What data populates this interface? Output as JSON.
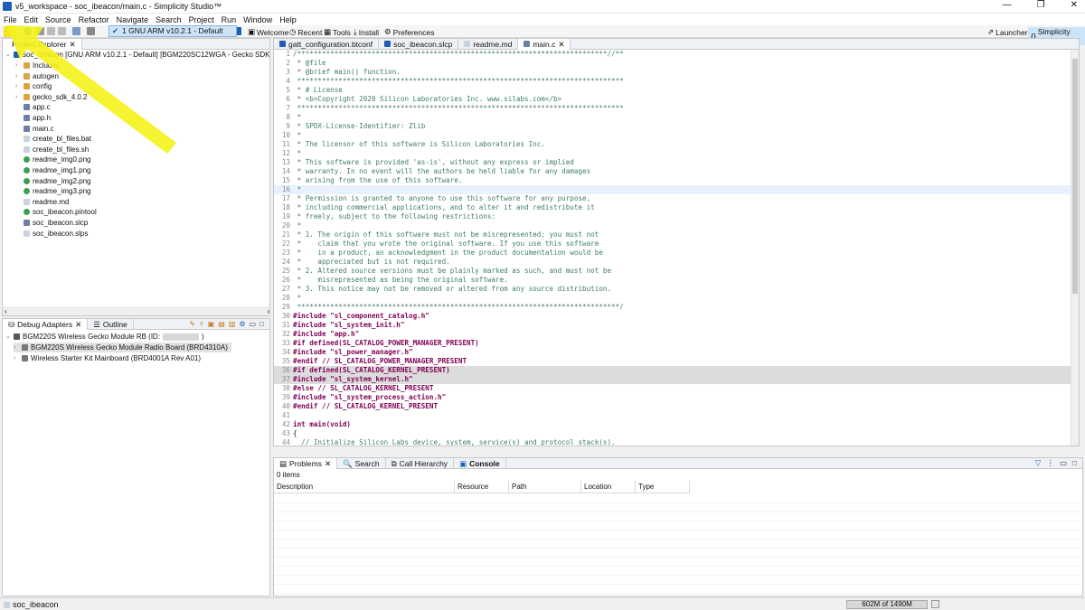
{
  "window": {
    "title": "v5_workspace - soc_ibeacon/main.c - Simplicity Studio™",
    "buttons": [
      "—",
      "❐",
      "✕"
    ]
  },
  "menu": [
    "File",
    "Edit",
    "Source",
    "Refactor",
    "Navigate",
    "Search",
    "Project",
    "Run",
    "Window",
    "Help"
  ],
  "toolbar": {
    "build_config": "1 GNU ARM v10.2.1 - Default",
    "links": [
      "Welcome",
      "Recent",
      "Tools",
      "Install",
      "Preferences"
    ],
    "perspectives": [
      "Launcher",
      "Simplicity IDE"
    ]
  },
  "project_explorer": {
    "tab_label": "Project Explorer",
    "root": "soc_ibeacon [GNU ARM v10.2.1 - Default] [BGM220SC12WGA - Gecko SDK Suite: A",
    "items": [
      {
        "label": "Includes",
        "type": "folder"
      },
      {
        "label": "autogen",
        "type": "folder"
      },
      {
        "label": "config",
        "type": "folder"
      },
      {
        "label": "gecko_sdk_4.0.2",
        "type": "folder"
      },
      {
        "label": "app.c",
        "type": "cfile"
      },
      {
        "label": "app.h",
        "type": "cfile"
      },
      {
        "label": "main.c",
        "type": "cfile"
      },
      {
        "label": "create_bl_files.bat",
        "type": "file"
      },
      {
        "label": "create_bl_files.sh",
        "type": "file"
      },
      {
        "label": "readme_img0.png",
        "type": "png"
      },
      {
        "label": "readme_img1.png",
        "type": "png"
      },
      {
        "label": "readme_img2.png",
        "type": "png"
      },
      {
        "label": "readme_img3.png",
        "type": "png"
      },
      {
        "label": "readme.md",
        "type": "file"
      },
      {
        "label": "soc_ibeacon.pintool",
        "type": "png"
      },
      {
        "label": "soc_ibeacon.slcp",
        "type": "cfile"
      },
      {
        "label": "soc_ibeacon.slps",
        "type": "file"
      }
    ]
  },
  "debug_adapters": {
    "tabs": [
      "Debug Adapters",
      "Outline"
    ],
    "items": [
      "BGM220S Wireless Gecko Module RB (ID:",
      "BGM220S Wireless Gecko Module Radio Board (BRD4310A)",
      "Wireless Starter Kit Mainboard (BRD4001A Rev A01)"
    ]
  },
  "editor": {
    "tabs": [
      "gatt_configuration.btconf",
      "soc_ibeacon.slcp",
      "readme.md",
      "main.c"
    ],
    "lines": [
      {
        "n": "1",
        "t": "/***************************************************************************//**",
        "c": "cm"
      },
      {
        "n": "2",
        "t": " * @file",
        "c": "cm"
      },
      {
        "n": "3",
        "t": " * @brief main() function.",
        "c": "cm"
      },
      {
        "n": "4",
        "t": " *******************************************************************************",
        "c": "cm"
      },
      {
        "n": "5",
        "t": " * # License",
        "c": "cm"
      },
      {
        "n": "6",
        "t": " * <b>Copyright 2020 Silicon Laboratories Inc. www.silabs.com</b>",
        "c": "cm"
      },
      {
        "n": "7",
        "t": " *******************************************************************************",
        "c": "cm"
      },
      {
        "n": "8",
        "t": " *",
        "c": "cm"
      },
      {
        "n": "9",
        "t": " * SPDX-License-Identifier: Zlib",
        "c": "cm"
      },
      {
        "n": "10",
        "t": " *",
        "c": "cm"
      },
      {
        "n": "11",
        "t": " * The licensor of this software is Silicon Laboratories Inc.",
        "c": "cm"
      },
      {
        "n": "12",
        "t": " *",
        "c": "cm"
      },
      {
        "n": "13",
        "t": " * This software is provided 'as-is', without any express or implied",
        "c": "cm"
      },
      {
        "n": "14",
        "t": " * warranty. In no event will the authors be held liable for any damages",
        "c": "cm"
      },
      {
        "n": "15",
        "t": " * arising from the use of this software.",
        "c": "cm"
      },
      {
        "n": "16",
        "t": " *",
        "c": "cm hl3"
      },
      {
        "n": "17",
        "t": " * Permission is granted to anyone to use this software for any purpose,",
        "c": "cm"
      },
      {
        "n": "18",
        "t": " * including commercial applications, and to alter it and redistribute it",
        "c": "cm"
      },
      {
        "n": "19",
        "t": " * freely, subject to the following restrictions:",
        "c": "cm"
      },
      {
        "n": "20",
        "t": " *",
        "c": "cm"
      },
      {
        "n": "21",
        "t": " * 1. The origin of this software must not be misrepresented; you must not",
        "c": "cm"
      },
      {
        "n": "22",
        "t": " *    claim that you wrote the original software. If you use this software",
        "c": "cm"
      },
      {
        "n": "23",
        "t": " *    in a product, an acknowledgment in the product documentation would be",
        "c": "cm"
      },
      {
        "n": "24",
        "t": " *    appreciated but is not required.",
        "c": "cm"
      },
      {
        "n": "25",
        "t": " * 2. Altered source versions must be plainly marked as such, and must not be",
        "c": "cm"
      },
      {
        "n": "26",
        "t": " *    misrepresented as being the original software.",
        "c": "cm"
      },
      {
        "n": "27",
        "t": " * 3. This notice may not be removed or altered from any source distribution.",
        "c": "cm"
      },
      {
        "n": "28",
        "t": " *",
        "c": "cm"
      },
      {
        "n": "29",
        "t": " ******************************************************************************/",
        "c": "cm"
      },
      {
        "n": "30",
        "t": "#include \"sl_component_catalog.h\"",
        "c": "inc"
      },
      {
        "n": "31",
        "t": "#include \"sl_system_init.h\"",
        "c": "inc"
      },
      {
        "n": "32",
        "t": "#include \"app.h\"",
        "c": "inc"
      },
      {
        "n": "33",
        "t": "#if defined(SL_CATALOG_POWER_MANAGER_PRESENT)",
        "c": "pp"
      },
      {
        "n": "34",
        "t": "#include \"sl_power_manager.h\"",
        "c": "inc"
      },
      {
        "n": "35",
        "t": "#endif // SL_CATALOG_POWER_MANAGER_PRESENT",
        "c": "pp"
      },
      {
        "n": "36",
        "t": "#if defined(SL_CATALOG_KERNEL_PRESENT)",
        "c": "pp hl2"
      },
      {
        "n": "37",
        "t": "#include \"sl_system_kernel.h\"",
        "c": "inc hl2"
      },
      {
        "n": "38",
        "t": "#else // SL_CATALOG_KERNEL_PRESENT",
        "c": "pp"
      },
      {
        "n": "39",
        "t": "#include \"sl_system_process_action.h\"",
        "c": "inc"
      },
      {
        "n": "40",
        "t": "#endif // SL_CATALOG_KERNEL_PRESENT",
        "c": "pp"
      },
      {
        "n": "41",
        "t": "",
        "c": ""
      },
      {
        "n": "42",
        "t": "int main(void)",
        "c": "fn"
      },
      {
        "n": "43",
        "t": "{",
        "c": ""
      },
      {
        "n": "44",
        "t": "  // Initialize Silicon Labs device, system, service(s) and protocol stack(s).",
        "c": "cm"
      }
    ]
  },
  "problems": {
    "tabs": [
      "Problems",
      "Search",
      "Call Hierarchy",
      "Console"
    ],
    "count": "0 items",
    "columns": [
      "Description",
      "Resource",
      "Path",
      "Location",
      "Type"
    ]
  },
  "status": {
    "left": "soc_ibeacon",
    "heap": "602M of 1490M"
  },
  "colors": {
    "accent": "#1c5fb5",
    "arrow": "#f5f21a"
  }
}
